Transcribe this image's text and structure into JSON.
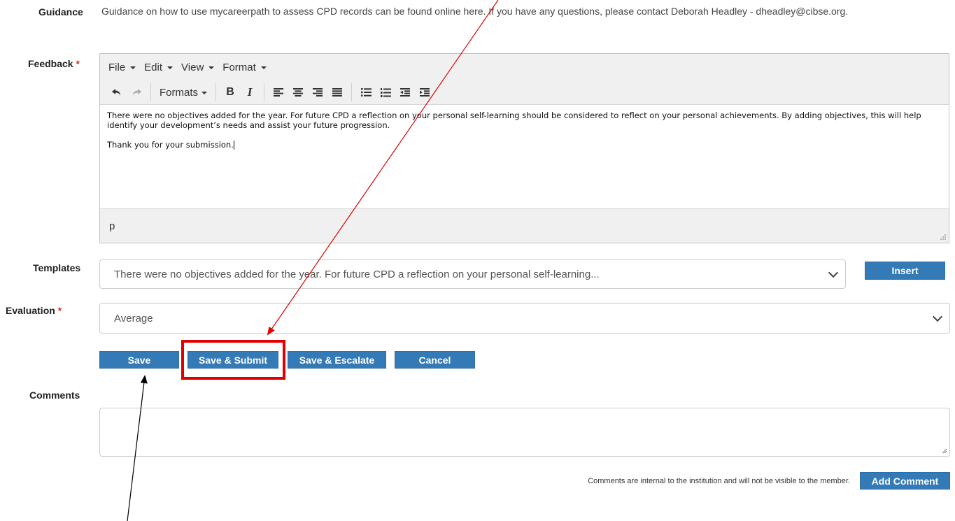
{
  "guidance": {
    "label": "Guidance",
    "text": "Guidance on how to use mycareerpath to assess CPD records can be found online here. If you have any questions, please contact Deborah Headley - dheadley@cibse.org."
  },
  "feedback": {
    "label": "Feedback",
    "required_mark": "*",
    "menus": [
      "File",
      "Edit",
      "View",
      "Format"
    ],
    "toolbar": {
      "formats_label": "Formats",
      "bold": "B",
      "italic": "I"
    },
    "content": {
      "para1": "There were no objectives added for the year. For future CPD a reflection on your personal self-learning should be considered to reflect on your personal achievements. By adding objectives, this will help identify your development’s needs and assist your future progression.",
      "para2": "Thank you for your submission."
    },
    "status_path": "p"
  },
  "templates": {
    "label": "Templates",
    "selected": "There were no objectives added for the year. For future CPD a reflection on your personal self-learning...",
    "insert_label": "Insert"
  },
  "evaluation": {
    "label": "Evaluation",
    "required_mark": "*",
    "selected": "Average"
  },
  "actions": {
    "save": "Save",
    "save_submit": "Save & Submit",
    "save_escalate": "Save & Escalate",
    "cancel": "Cancel"
  },
  "comments": {
    "label": "Comments",
    "note": "Comments are internal to the institution and will not be visible to the member.",
    "add_label": "Add Comment"
  },
  "colors": {
    "button_blue": "#337ab7",
    "highlight_red": "#e00000",
    "required_red": "#c9302c"
  }
}
